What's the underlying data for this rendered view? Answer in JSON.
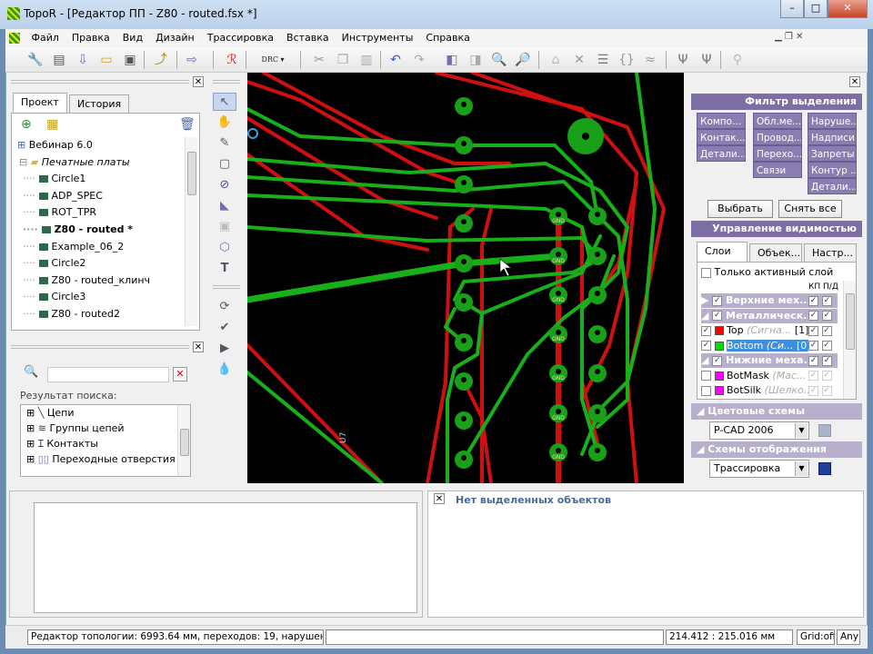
{
  "window": {
    "title": "TopoR - [Редактор ПП - Z80 - routed.fsx *]",
    "minimize": "–",
    "maximize": "□",
    "close": "✕"
  },
  "menu": [
    "Файл",
    "Правка",
    "Вид",
    "Дизайн",
    "Трассировка",
    "Вставка",
    "Инструменты",
    "Справка"
  ],
  "toolbar": {
    "drc_label": "DRC"
  },
  "project_panel": {
    "tabs": [
      "Проект",
      "История"
    ],
    "active_tab": "Проект",
    "root": "Вебинар 6.0",
    "folder": "Печатные платы",
    "boards": [
      "Circle1",
      "ADP_SPEC",
      "ROT_TPR",
      "Z80 - routed *",
      "Example_06_2",
      "Circle2",
      "Z80 - routed_клинч",
      "Circle3",
      "Z80 - routed2"
    ],
    "active_board": "Z80 - routed *"
  },
  "search_panel": {
    "query": "",
    "results_label": "Результат поиска:",
    "results": [
      "Цепи",
      "Группы цепей",
      "Контакты",
      "Переходные отверстия"
    ]
  },
  "canvas": {
    "pad_label": "GND",
    "ref_label": "U7",
    "colors": {
      "top": "#d01010",
      "bottom": "#18b018",
      "background": "#000000"
    }
  },
  "selection_filter": {
    "title": "Фильтр выделения",
    "col1": [
      "Компо...",
      "Контак...",
      "Детали..."
    ],
    "col2": [
      "Обл.ме...",
      "Провод...",
      "Перехо...",
      "Связи"
    ],
    "col3": [
      "Наруше...",
      "Надписи",
      "Запреты",
      "Контур ...",
      "Детали..."
    ],
    "select_all": "Выбрать все",
    "clear_all": "Снять все"
  },
  "visibility": {
    "title": "Управление видимостью",
    "tabs": [
      "Слои",
      "Объек...",
      "Настр..."
    ],
    "active_tab": "Слои",
    "only_active_layer": "Только активный слой",
    "col_headers": "КП П/Д",
    "layers": [
      {
        "name": "Верхние мех...",
        "group": true,
        "checked": true
      },
      {
        "name": "Металлическ...",
        "group": true,
        "checked": true
      },
      {
        "name": "Top",
        "type": "(Сигна...",
        "index": "[1]",
        "color": "#ff0000",
        "checked": true
      },
      {
        "name": "Bottom",
        "type": "(Си...",
        "index": "[0]",
        "color": "#00e000",
        "checked": true,
        "selected": true
      },
      {
        "name": "Нижние меха...",
        "group": true,
        "checked": true
      },
      {
        "name": "BotMask",
        "type": "(Мас...",
        "color": "#ff00ff",
        "checked": false
      },
      {
        "name": "BotSilk",
        "type": "(Шелко...",
        "color": "#ff00ff",
        "checked": false
      }
    ]
  },
  "color_schemes": {
    "title": "Цветовые схемы",
    "value": "P-CAD 2006"
  },
  "display_schemes": {
    "title": "Схемы отображения",
    "value": "Трассировка"
  },
  "properties_panel": {
    "message": "Нет выделенных объектов"
  },
  "status": {
    "info": "Редактор топологии: 6993.64 мм, переходов: 19, нарушений: 0",
    "coords": "214.412 : 215.016 мм",
    "grid": "Grid:off",
    "mode": "Any"
  }
}
